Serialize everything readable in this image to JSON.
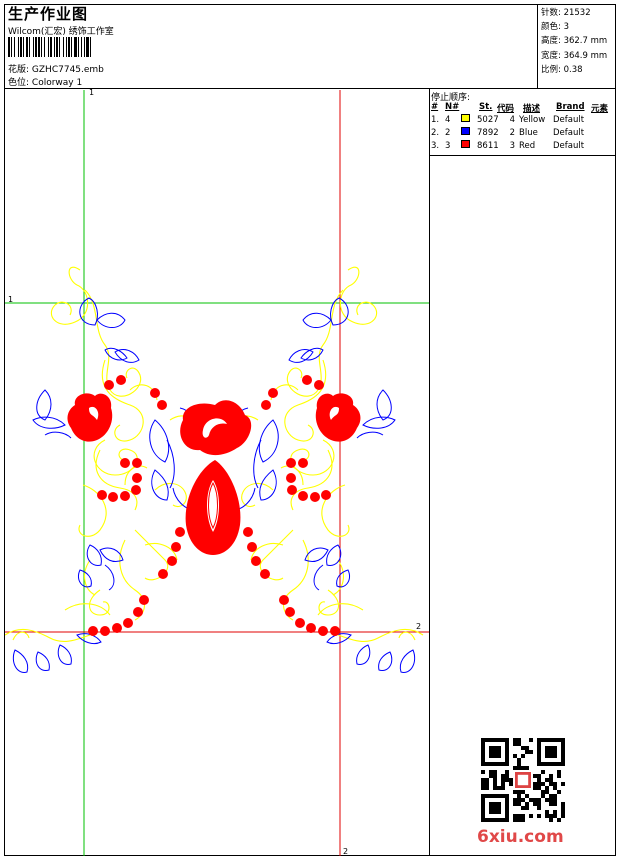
{
  "header": {
    "title": "生产作业图",
    "studio": "Wilcom(汇宏) 绣饰工作室",
    "design_label": "花版:",
    "design_file": "GZHC7745.emb",
    "colorway_label": "色位:",
    "colorway": "Colorway 1"
  },
  "stats": [
    {
      "label": "针数:",
      "value": "21532"
    },
    {
      "label": "颜色:",
      "value": "3"
    },
    {
      "label": "高度:",
      "value": "362.7 mm"
    },
    {
      "label": "宽度:",
      "value": "364.9 mm"
    },
    {
      "label": "比例:",
      "value": "0.38"
    }
  ],
  "stop_sequence": {
    "title": "停止顺序:",
    "headers": {
      "num": "#",
      "n": "N#",
      "st": "St.",
      "code": "代码",
      "desc": "描述",
      "brand": "Brand",
      "element": "元素"
    },
    "rows": [
      {
        "num": "1.",
        "n": "4",
        "st": "5027",
        "code": "4",
        "desc": "Yellow",
        "brand": "Default",
        "color": "#ffff00"
      },
      {
        "num": "2.",
        "n": "2",
        "st": "7892",
        "code": "2",
        "desc": "Blue",
        "brand": "Default",
        "color": "#0000ff"
      },
      {
        "num": "3.",
        "n": "3",
        "st": "8611",
        "code": "3",
        "desc": "Red",
        "brand": "Default",
        "color": "#ff0000"
      }
    ]
  },
  "guides": {
    "green_label": "1",
    "red_label": "2"
  },
  "colors": {
    "green": "#00c000",
    "red": "#e00000",
    "yellow": "#ffff00",
    "blue": "#0000ff",
    "embroidery_red": "#ff0000"
  },
  "watermark": "6xiu.com"
}
